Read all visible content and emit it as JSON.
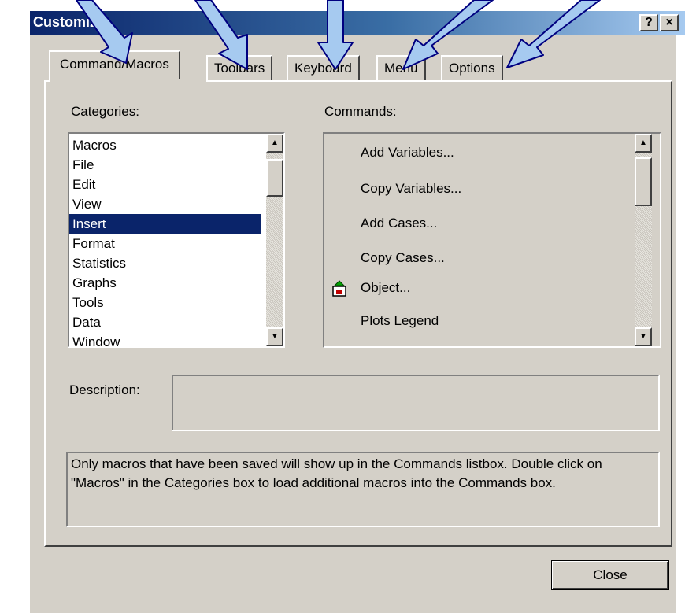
{
  "window": {
    "title": "Customize",
    "help_label": "?",
    "close_label": "×"
  },
  "tabs": [
    {
      "label": "Command/Macros",
      "active": true
    },
    {
      "label": "Toolbars",
      "active": false
    },
    {
      "label": "Keyboard",
      "active": false
    },
    {
      "label": "Menu",
      "active": false
    },
    {
      "label": "Options",
      "active": false
    }
  ],
  "categories": {
    "label": "Categories:",
    "items": [
      "Macros",
      "File",
      "Edit",
      "View",
      "Insert",
      "Format",
      "Statistics",
      "Graphs",
      "Tools",
      "Data",
      "Window"
    ],
    "selected": "Insert"
  },
  "commands": {
    "label": "Commands:",
    "items": [
      "Add Variables...",
      "Copy Variables...",
      "Add Cases...",
      "Copy Cases...",
      "Object...",
      "Plots Legend"
    ]
  },
  "description": {
    "label": "Description:",
    "value": ""
  },
  "note": "Only macros that have been saved will show up in the Commands listbox. Double click on \"Macros\" in the Categories box to load additional macros into the Commands box.",
  "buttons": {
    "close": "Close"
  },
  "colors": {
    "arrow_fill": "#a6caf0",
    "arrow_stroke": "#000080",
    "selection": "#0a246a",
    "dialog": "#d4d0c8"
  },
  "icons": {
    "object": "insert-object-icon",
    "scroll_up": "scroll-up-arrow-icon",
    "scroll_down": "scroll-down-arrow-icon"
  }
}
